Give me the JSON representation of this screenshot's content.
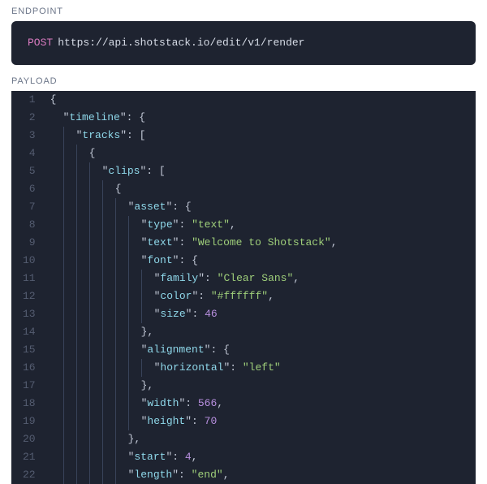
{
  "labels": {
    "endpoint": "ENDPOINT",
    "payload": "PAYLOAD"
  },
  "endpoint": {
    "method": "POST",
    "url": "https://api.shotstack.io/edit/v1/render"
  },
  "code": {
    "lines": [
      {
        "n": 1,
        "indent": 0,
        "tokens": [
          {
            "t": "punct",
            "v": "{"
          }
        ]
      },
      {
        "n": 2,
        "indent": 1,
        "tokens": [
          {
            "t": "key",
            "v": "timeline"
          },
          {
            "t": "punct",
            "v": ": "
          },
          {
            "t": "punct",
            "v": "{"
          }
        ]
      },
      {
        "n": 3,
        "indent": 2,
        "tokens": [
          {
            "t": "key",
            "v": "tracks"
          },
          {
            "t": "punct",
            "v": ": "
          },
          {
            "t": "punct",
            "v": "["
          }
        ]
      },
      {
        "n": 4,
        "indent": 3,
        "tokens": [
          {
            "t": "punct",
            "v": "{"
          }
        ]
      },
      {
        "n": 5,
        "indent": 4,
        "tokens": [
          {
            "t": "key",
            "v": "clips"
          },
          {
            "t": "punct",
            "v": ": "
          },
          {
            "t": "punct",
            "v": "["
          }
        ]
      },
      {
        "n": 6,
        "indent": 5,
        "tokens": [
          {
            "t": "punct",
            "v": "{"
          }
        ]
      },
      {
        "n": 7,
        "indent": 6,
        "tokens": [
          {
            "t": "key",
            "v": "asset"
          },
          {
            "t": "punct",
            "v": ": "
          },
          {
            "t": "punct",
            "v": "{"
          }
        ]
      },
      {
        "n": 8,
        "indent": 7,
        "tokens": [
          {
            "t": "key",
            "v": "type"
          },
          {
            "t": "punct",
            "v": ": "
          },
          {
            "t": "str",
            "v": "text"
          },
          {
            "t": "punct",
            "v": ","
          }
        ]
      },
      {
        "n": 9,
        "indent": 7,
        "tokens": [
          {
            "t": "key",
            "v": "text"
          },
          {
            "t": "punct",
            "v": ": "
          },
          {
            "t": "str",
            "v": "Welcome to Shotstack"
          },
          {
            "t": "punct",
            "v": ","
          }
        ]
      },
      {
        "n": 10,
        "indent": 7,
        "tokens": [
          {
            "t": "key",
            "v": "font"
          },
          {
            "t": "punct",
            "v": ": "
          },
          {
            "t": "punct",
            "v": "{"
          }
        ]
      },
      {
        "n": 11,
        "indent": 8,
        "tokens": [
          {
            "t": "key",
            "v": "family"
          },
          {
            "t": "punct",
            "v": ": "
          },
          {
            "t": "str",
            "v": "Clear Sans"
          },
          {
            "t": "punct",
            "v": ","
          }
        ]
      },
      {
        "n": 12,
        "indent": 8,
        "tokens": [
          {
            "t": "key",
            "v": "color"
          },
          {
            "t": "punct",
            "v": ": "
          },
          {
            "t": "str",
            "v": "#ffffff"
          },
          {
            "t": "punct",
            "v": ","
          }
        ]
      },
      {
        "n": 13,
        "indent": 8,
        "tokens": [
          {
            "t": "key",
            "v": "size"
          },
          {
            "t": "punct",
            "v": ": "
          },
          {
            "t": "num",
            "v": "46"
          }
        ]
      },
      {
        "n": 14,
        "indent": 7,
        "tokens": [
          {
            "t": "punct",
            "v": "},"
          }
        ]
      },
      {
        "n": 15,
        "indent": 7,
        "tokens": [
          {
            "t": "key",
            "v": "alignment"
          },
          {
            "t": "punct",
            "v": ": "
          },
          {
            "t": "punct",
            "v": "{"
          }
        ]
      },
      {
        "n": 16,
        "indent": 8,
        "tokens": [
          {
            "t": "key",
            "v": "horizontal"
          },
          {
            "t": "punct",
            "v": ": "
          },
          {
            "t": "str",
            "v": "left"
          }
        ]
      },
      {
        "n": 17,
        "indent": 7,
        "tokens": [
          {
            "t": "punct",
            "v": "},"
          }
        ]
      },
      {
        "n": 18,
        "indent": 7,
        "tokens": [
          {
            "t": "key",
            "v": "width"
          },
          {
            "t": "punct",
            "v": ": "
          },
          {
            "t": "num",
            "v": "566"
          },
          {
            "t": "punct",
            "v": ","
          }
        ]
      },
      {
        "n": 19,
        "indent": 7,
        "tokens": [
          {
            "t": "key",
            "v": "height"
          },
          {
            "t": "punct",
            "v": ": "
          },
          {
            "t": "num",
            "v": "70"
          }
        ]
      },
      {
        "n": 20,
        "indent": 6,
        "tokens": [
          {
            "t": "punct",
            "v": "},"
          }
        ]
      },
      {
        "n": 21,
        "indent": 6,
        "tokens": [
          {
            "t": "key",
            "v": "start"
          },
          {
            "t": "punct",
            "v": ": "
          },
          {
            "t": "num",
            "v": "4"
          },
          {
            "t": "punct",
            "v": ","
          }
        ]
      },
      {
        "n": 22,
        "indent": 6,
        "tokens": [
          {
            "t": "key",
            "v": "length"
          },
          {
            "t": "punct",
            "v": ": "
          },
          {
            "t": "str",
            "v": "end"
          },
          {
            "t": "punct",
            "v": ","
          }
        ]
      }
    ]
  }
}
